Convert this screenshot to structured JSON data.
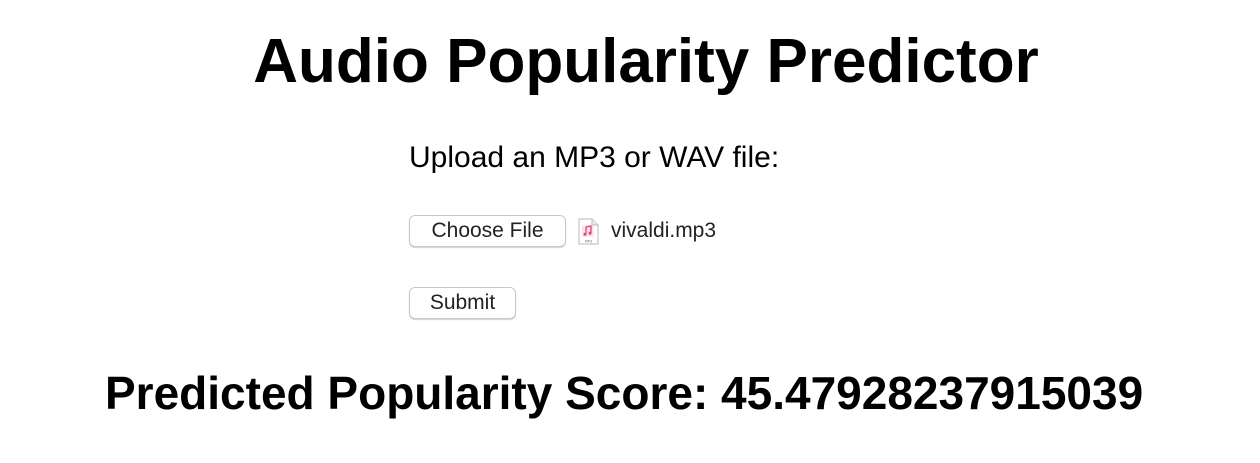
{
  "page": {
    "title": "Audio Popularity Predictor"
  },
  "upload": {
    "label": "Upload an MP3 or WAV file:",
    "choose_button_label": "Choose File",
    "file_icon": "audio-file-icon",
    "file_icon_text": "MP3",
    "selected_file": "vivaldi.mp3",
    "submit_label": "Submit"
  },
  "result": {
    "text": "Predicted Popularity Score: 45.47928237915039"
  },
  "colors": {
    "text": "#000000",
    "button_border": "#c8c8c8",
    "icon_accent": "#e0447a"
  }
}
